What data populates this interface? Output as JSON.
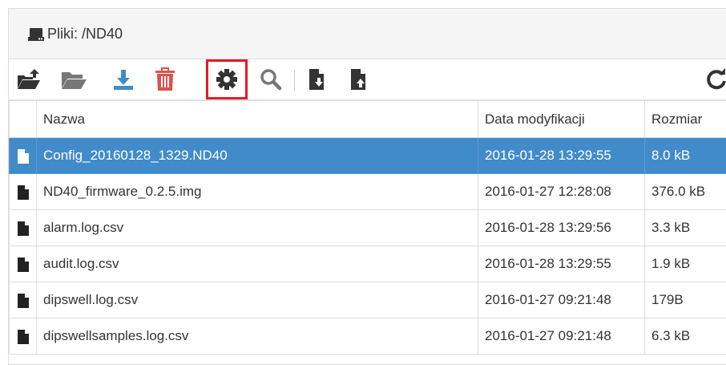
{
  "header": {
    "title": "Pliki: /ND40",
    "icon": "hdd-icon"
  },
  "toolbar": {
    "buttons": [
      {
        "name": "upload-folder-icon",
        "color": "#333333"
      },
      {
        "name": "open-folder-icon",
        "color": "#777777"
      },
      {
        "name": "download-icon",
        "color": "#428bca"
      },
      {
        "name": "trash-icon",
        "color": "#d9534f"
      },
      {
        "name": "gear-icon",
        "color": "#333333",
        "highlighted": true,
        "highlight_color": "#e31b23"
      },
      {
        "name": "search-icon",
        "color": "#777777"
      },
      {
        "name": "import-file-icon",
        "color": "#333333"
      },
      {
        "name": "export-file-icon",
        "color": "#333333"
      },
      {
        "name": "refresh-icon",
        "color": "#333333"
      }
    ]
  },
  "table": {
    "columns": [
      "Nazwa",
      "Data modyfikacji",
      "Rozmiar"
    ],
    "rows": [
      {
        "name": "Config_20160128_1329.ND40",
        "date": "2016-01-28 13:29:55",
        "size": "8.0 kB",
        "selected": true
      },
      {
        "name": "ND40_firmware_0.2.5.img",
        "date": "2016-01-27 12:28:08",
        "size": "376.0 kB"
      },
      {
        "name": "alarm.log.csv",
        "date": "2016-01-28 13:29:56",
        "size": "3.3 kB"
      },
      {
        "name": "audit.log.csv",
        "date": "2016-01-28 13:29:55",
        "size": "1.9 kB"
      },
      {
        "name": "dipswell.log.csv",
        "date": "2016-01-27 09:21:48",
        "size": "179B"
      },
      {
        "name": "dipswellsamples.log.csv",
        "date": "2016-01-27 09:21:48",
        "size": "6.3 kB"
      }
    ]
  },
  "colors": {
    "selected_row": "#428bca",
    "accent": "#428bca",
    "danger": "#d9534f"
  }
}
